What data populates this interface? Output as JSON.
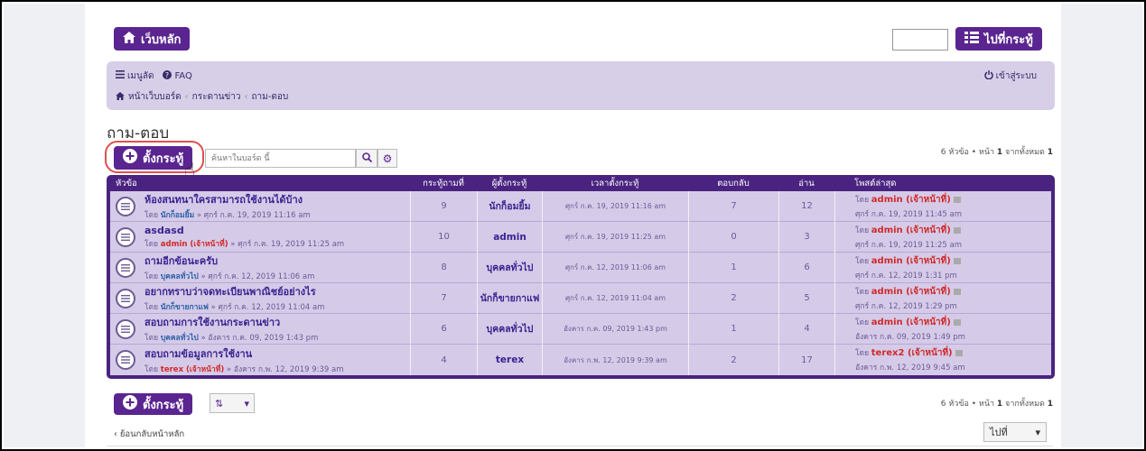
{
  "header": {
    "home_label": "เว็บหลัก",
    "jump_label": "ไปที่กระทู้"
  },
  "navbar": {
    "menu_label": "เมนูลัด",
    "faq_label": "FAQ",
    "login_label": "เข้าสู่ระบบ",
    "breadcrumb": [
      "หน้าเว็บบอร์ด",
      "กระดานข่าว",
      "ถาม-ตอบ"
    ]
  },
  "forum": {
    "title": "ถาม-ตอบ",
    "new_topic_label": "ตั้งกระทู้",
    "search_placeholder": "ค้นหาในบอร์ด นี้",
    "pagination_text_1": "6 หัวข้อ • หน้า ",
    "pagination_page": "1",
    "pagination_text_2": " จากทั้งหมด ",
    "pagination_total": "1"
  },
  "table": {
    "headers": {
      "topic": "หัวข้อ",
      "replies": "กระทู้ถามที่",
      "author": "ผู้ตั้งกระทู้",
      "time": "เวลาตั้งกระทู้",
      "answers": "ตอบกลับ",
      "reads": "อ่าน",
      "last_post": "โพสต์ล่าสุด"
    },
    "rows": [
      {
        "title": "ห้องสนทนาใครสามารถใช้งานได้บ้าง",
        "meta_prefix": "โดย ",
        "meta_author": "นักก็อมยิ้ม",
        "meta_suffix": " » ศุกร์ ก.ค. 19, 2019 11:16 am",
        "replies": "9",
        "author": "นักก็อมยิ้ม",
        "time": "ศุกร์ ก.ค. 19, 2019 11:16 am",
        "answers": "7",
        "reads": "12",
        "last_prefix": "โดย ",
        "last_author": "admin (เจ้าหน้าที่)",
        "last_time": "ศุกร์ ก.ค. 19, 2019 11:45 am"
      },
      {
        "title": "asdasd",
        "meta_prefix": "โดย ",
        "meta_author": "admin (เจ้าหน้าที่)",
        "meta_suffix": " » ศุกร์ ก.ค. 19, 2019 11:25 am",
        "replies": "10",
        "author": "admin",
        "time": "ศุกร์ ก.ค. 19, 2019 11:25 am",
        "answers": "0",
        "reads": "3",
        "last_prefix": "โดย ",
        "last_author": "admin (เจ้าหน้าที่)",
        "last_time": "ศุกร์ ก.ค. 19, 2019 11:25 am"
      },
      {
        "title": "ถามอีกข้อนะครับ",
        "meta_prefix": "โดย ",
        "meta_author": "บุคคลทั่วไป",
        "meta_suffix": " » ศุกร์ ก.ค. 12, 2019 11:06 am",
        "replies": "8",
        "author": "บุคคลทั่วไป",
        "time": "ศุกร์ ก.ค. 12, 2019 11:06 am",
        "answers": "1",
        "reads": "6",
        "last_prefix": "โดย ",
        "last_author": "admin (เจ้าหน้าที่)",
        "last_time": "ศุกร์ ก.ค. 12, 2019 1:31 pm"
      },
      {
        "title": "อยากทราบว่าจดทะเบียนพาณิชย์อย่างไร",
        "meta_prefix": "โดย ",
        "meta_author": "นักก็ขายกาแฟ",
        "meta_suffix": " » ศุกร์ ก.ค. 12, 2019 11:04 am",
        "replies": "7",
        "author": "นักก็ขายกาแฟ",
        "time": "ศุกร์ ก.ค. 12, 2019 11:04 am",
        "answers": "2",
        "reads": "5",
        "last_prefix": "โดย ",
        "last_author": "admin (เจ้าหน้าที่)",
        "last_time": "ศุกร์ ก.ค. 12, 2019 1:29 pm"
      },
      {
        "title": "สอบถามการใช้งานกระดานข่าว",
        "meta_prefix": "โดย ",
        "meta_author": "บุคคลทั่วไป",
        "meta_suffix": " » อังคาร ก.ค. 09, 2019 1:43 pm",
        "replies": "6",
        "author": "บุคคลทั่วไป",
        "time": "อังคาร ก.ค. 09, 2019 1:43 pm",
        "answers": "1",
        "reads": "4",
        "last_prefix": "โดย ",
        "last_author": "admin (เจ้าหน้าที่)",
        "last_time": "อังคาร ก.ค. 09, 2019 1:49 pm"
      },
      {
        "title": "สอบถามข้อมูลการใช้งาน",
        "meta_prefix": "โดย ",
        "meta_author": "terex (เจ้าหน้าที่)",
        "meta_suffix": " » อังคาร ก.พ. 12, 2019 9:39 am",
        "replies": "4",
        "author": "terex",
        "time": "อังคาร ก.พ. 12, 2019 9:39 am",
        "answers": "2",
        "reads": "17",
        "last_prefix": "โดย ",
        "last_author": "terex2 (เจ้าหน้าที่)",
        "last_time": "อังคาร ก.พ. 12, 2019 9:45 am"
      }
    ]
  },
  "footer": {
    "new_topic_label": "ตั้งกระทู้",
    "back_label": "ย้อนกลับหน้าหลัก",
    "goto_label": "ไปที่"
  },
  "colors": {
    "brand_purple": "#5a2590",
    "row_bg": "#d5cbe8",
    "navbar_bg": "#d7cfe8",
    "admin_red": "#d02a2a"
  },
  "icons": {
    "home": "home-icon",
    "list": "list-icon",
    "menu": "menu-icon",
    "faq": "question-icon",
    "power": "power-icon",
    "plus": "plus-circle-icon",
    "search": "search-icon",
    "gear": "gear-icon",
    "topic": "topic-read-icon",
    "sort": "sort-icon",
    "chevron": "chevron-down-icon",
    "back": "chevron-left-icon"
  }
}
